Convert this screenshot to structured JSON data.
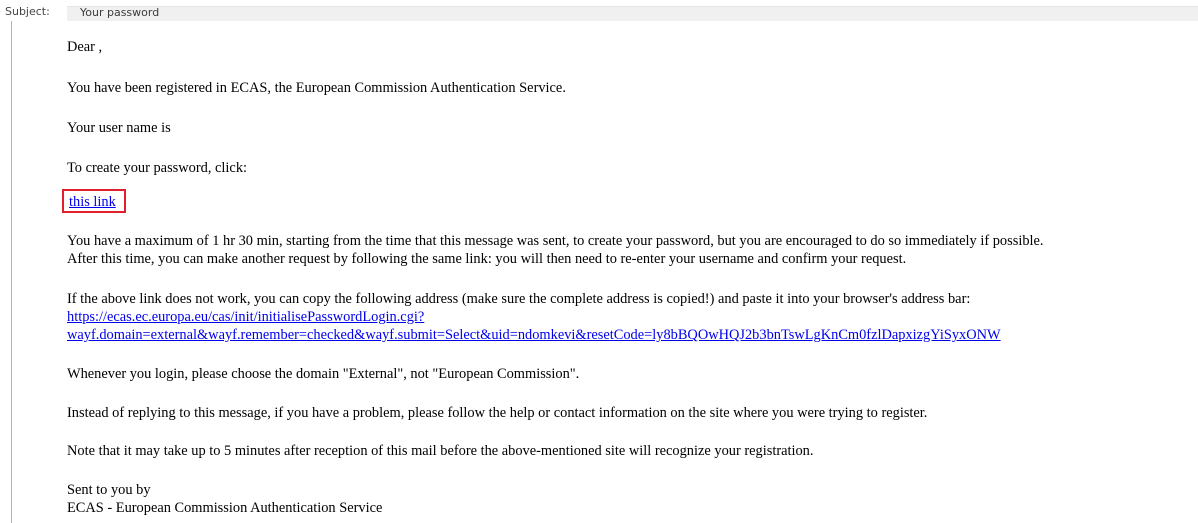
{
  "header": {
    "subject_label": "Subject:",
    "subject_value": "Your password"
  },
  "email": {
    "greeting": "Dear ,",
    "registered": "You have been registered in ECAS, the European Commission Authentication Service.",
    "username": "Your user name is",
    "create_prompt": "To create your password, click:",
    "link_label": "this link",
    "max_time_line1": "You have a maximum of 1 hr 30 min, starting from the time that this message was sent, to create your password, but you are encouraged to do so immediately if possible.",
    "max_time_line2": "After this time, you can make another request by following the same link: you will then need to re-enter your username and confirm your request.",
    "fallback_text": "If the above link does not work, you can copy the following address (make sure the complete address is copied!) and paste it into your browser's address bar:",
    "fallback_url_line1": "https://ecas.ec.europa.eu/cas/init/initialisePasswordLogin.cgi?",
    "fallback_url_line2": "wayf.domain=external&wayf.remember=checked&wayf.submit=Select&uid=ndomkevi&resetCode=ly8bBQOwHQJ2b3bnTswLgKnCm0fzlDapxizgYiSyxONW",
    "domain_note": "Whenever you login, please choose the domain \"External\", not \"European Commission\".",
    "help_note": "Instead of replying to this message, if you have a problem, please follow the help or contact information on the site where you were trying to register.",
    "delay_note": "Note that it may take up to 5 minutes after reception of this mail before the above-mentioned site will recognize your registration.",
    "sent_by": "Sent to you by",
    "signature": "ECAS - European Commission Authentication Service"
  },
  "colors": {
    "link": "#0000ee",
    "highlight_box": "#e0202c"
  }
}
